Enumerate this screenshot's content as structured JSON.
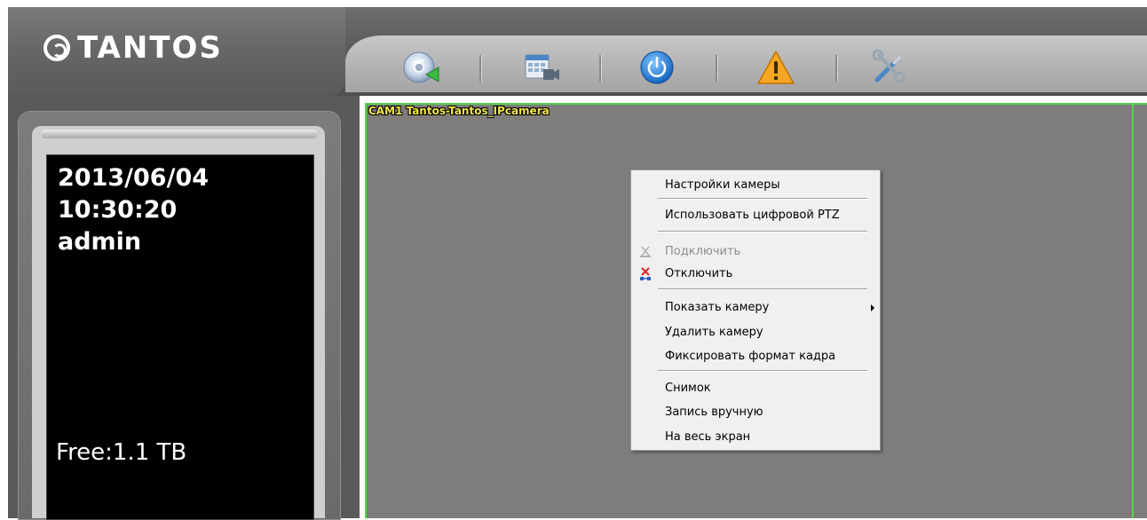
{
  "app": {
    "logo_text": "TANTOS",
    "accent_green": "#52d64a",
    "cam_title_color": "#f2e64a"
  },
  "toolbar": {
    "buttons": [
      {
        "icon": "disc-playback-icon"
      },
      {
        "icon": "schedule-camera-icon"
      },
      {
        "icon": "power-icon"
      },
      {
        "icon": "warning-icon"
      },
      {
        "icon": "tools-icon"
      }
    ]
  },
  "info_panel": {
    "date": "2013/06/04",
    "time": "10:30:20",
    "user": "admin",
    "free_space": "Free:1.1 TB"
  },
  "camera": {
    "title": "CAM1 Tantos-Tantos_IPcamera"
  },
  "context_menu": {
    "camera_settings": "Настройки камеры",
    "digital_ptz": "Использовать цифровой PTZ",
    "connect": "Подключить",
    "disconnect": "Отключить",
    "show_camera": "Показать камеру",
    "delete_camera": "Удалить камеру",
    "fix_aspect": "Фиксировать формат кадра",
    "snapshot": "Снимок",
    "manual_record": "Запись  вручную",
    "fullscreen": "На весь экран"
  }
}
